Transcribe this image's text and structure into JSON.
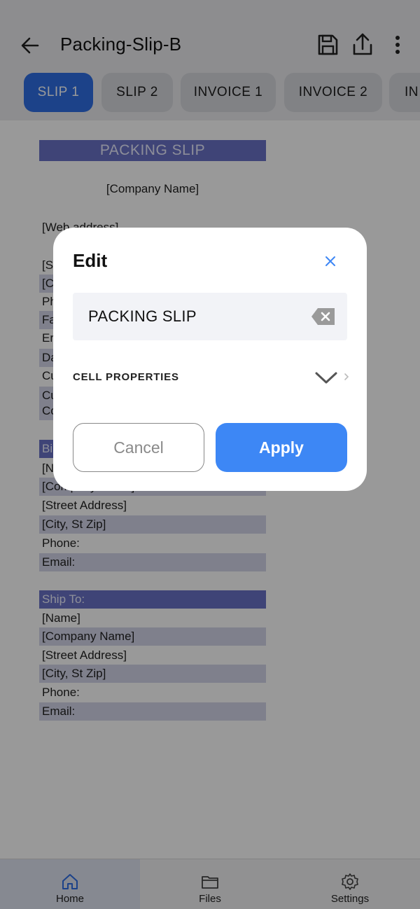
{
  "header": {
    "title": "Packing-Slip-B",
    "tabs": [
      "SLIP 1",
      "SLIP 2",
      "INVOICE 1",
      "INVOICE 2",
      "IN"
    ],
    "active_tab": 0
  },
  "sheet": {
    "title": "PACKING SLIP",
    "company_name": "[Company Name]",
    "web_address": "[Web address]",
    "left_fragments": [
      "[S",
      "[C",
      "Ph",
      "Fa",
      "Er",
      "Da",
      "Cu",
      "Cu",
      "Co"
    ],
    "bill_to_fragment": "Bi",
    "bill_to_name_fragment": "[N",
    "bill_to_company_fragment": "[Company Name]",
    "bill_to_street": "[Street Address]",
    "bill_to_city": "[City, St  Zip]",
    "bill_to_phone": "Phone:",
    "bill_to_email": "Email:",
    "ship_to_header": "Ship To:",
    "ship_to_name": "[Name]",
    "ship_to_company": "[Company Name]",
    "ship_to_street": "[Street Address]",
    "ship_to_city": "[City, St  Zip]",
    "ship_to_phone": "Phone:",
    "ship_to_email": "Email:"
  },
  "dialog": {
    "title": "Edit",
    "input_value": "PACKING SLIP",
    "cell_properties_label": "CELL PROPERTIES",
    "cancel_label": "Cancel",
    "apply_label": "Apply",
    "accent_color": "#3d87f5"
  },
  "bottom_nav": {
    "items": [
      {
        "label": "Home",
        "icon": "home-icon"
      },
      {
        "label": "Files",
        "icon": "folder-icon"
      },
      {
        "label": "Settings",
        "icon": "gear-icon"
      }
    ],
    "active_index": 0
  }
}
